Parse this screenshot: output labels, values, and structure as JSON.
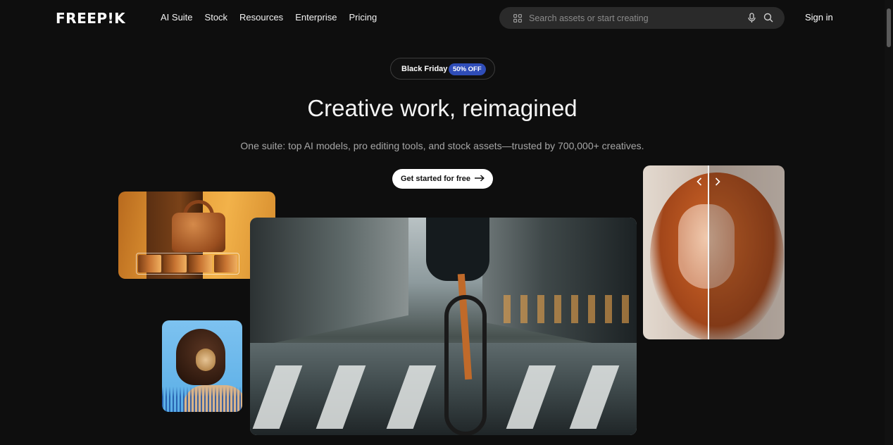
{
  "header": {
    "logo": "FREEP!K",
    "nav": [
      "AI Suite",
      "Stock",
      "Resources",
      "Enterprise",
      "Pricing"
    ],
    "search": {
      "placeholder": "Search assets or start creating",
      "icons": [
        "grid-icon",
        "microphone-icon",
        "search-icon"
      ]
    },
    "signin": "Sign in"
  },
  "hero": {
    "promo_label": "Black Friday",
    "promo_badge": "50% OFF",
    "headline": "Creative work, reimagined",
    "subhead": "One suite: top AI models, pro editing tools, and stock assets—trusted by 700,000+ creatives.",
    "cta": "Get started for free",
    "cta_icon": "arrow-right-icon"
  },
  "colors": {
    "background": "#0e0e0e",
    "badge": "#2f4db8",
    "search_bg": "#2a2a2a"
  }
}
